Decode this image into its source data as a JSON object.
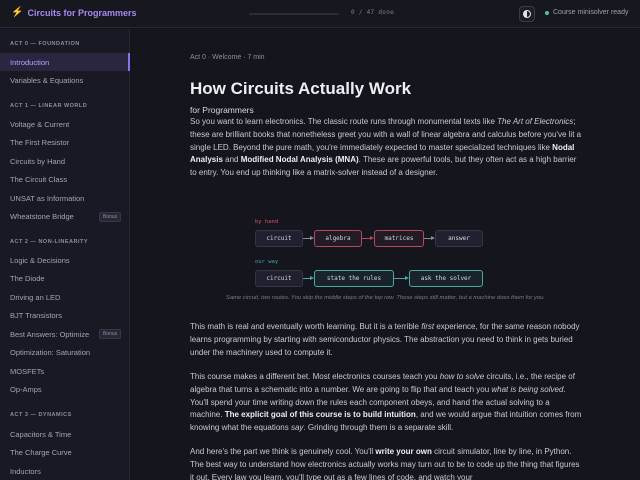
{
  "topbar": {
    "brand_label": "Circuits for Programmers",
    "progress_fraction": 0,
    "progress_text": "0 / 47 done",
    "status_text": "Course minisolver ready"
  },
  "sidebar": {
    "sections": [
      {
        "title": "ACT 0 — FOUNDATION",
        "items": [
          {
            "label": "Introduction",
            "active": true
          },
          {
            "label": "Variables & Equations"
          }
        ]
      },
      {
        "title": "ACT 1 — LINEAR WORLD",
        "items": [
          {
            "label": "Voltage & Current"
          },
          {
            "label": "The First Resistor"
          },
          {
            "label": "Circuits by Hand"
          },
          {
            "label": "The Circuit Class"
          },
          {
            "label": "UNSAT as Information"
          },
          {
            "label": "Wheatstone Bridge",
            "badge": "Bonus"
          }
        ]
      },
      {
        "title": "ACT 2 — NON-LINEARITY",
        "items": [
          {
            "label": "Logic & Decisions"
          },
          {
            "label": "The Diode"
          },
          {
            "label": "Driving an LED"
          },
          {
            "label": "BJT Transistors"
          },
          {
            "label": "Best Answers: Optimize",
            "badge": "Bonus"
          },
          {
            "label": "Optimization: Saturation"
          },
          {
            "label": "MOSFETs"
          },
          {
            "label": "Op-Amps"
          }
        ]
      },
      {
        "title": "ACT 3 — DYNAMICS",
        "items": [
          {
            "label": "Capacitors & Time"
          },
          {
            "label": "The Charge Curve"
          },
          {
            "label": "Inductors"
          }
        ]
      }
    ]
  },
  "main": {
    "breadcrumb": "Act 0 · Welcome · 7 min",
    "title": "How Circuits Actually Work",
    "subtitle": "for Programmers",
    "diagram": {
      "row1_label": "by hand",
      "row1_boxes": [
        "circuit",
        "algebra",
        "matrices",
        "answer"
      ],
      "row2_label": "our way",
      "row2_boxes": [
        "circuit",
        "state the rules",
        "ask the solver"
      ],
      "caption": "Same circuit, two routes. You skip the middle steps of the top row. Those steps still matter, but a machine does them for you."
    },
    "p1": {
      "a": "So you want to learn electronics. The classic route runs through monumental texts like ",
      "b": "The Art of Electronics",
      "c": "; these are brilliant books that nonetheless greet you with a wall of linear algebra and calculus before you've lit a single LED. Beyond the pure math, you're immediately expected to master specialized techniques like ",
      "d": "Nodal Analysis",
      "e": " and ",
      "f": "Modified Nodal Analysis (MNA)",
      "g": ". These are powerful tools, but they often act as a high barrier to entry. You end up thinking like a matrix-solver instead of a designer."
    },
    "p2": {
      "a": "This math is real and eventually worth learning. But it is a terrible ",
      "b": "first",
      "c": " experience, for the same reason nobody learns programming by starting with semiconductor physics. The abstraction you need to think in gets buried under the machinery used to compute it."
    },
    "p3": {
      "a": "This course makes a different bet. Most electronics courses teach you ",
      "b": "how to solve",
      "c": " circuits, i.e., the recipe of algebra that turns a schematic into a number. We are going to flip that and teach you ",
      "d": "what is being solved",
      "e": ". You'll spend your time writing down the rules each component obeys, and hand the actual solving to a machine. ",
      "f": "The explicit goal of this course is to build intuition",
      "g": ", and we would argue that intuition comes from knowing what the equations ",
      "h": "say",
      "i": ". Grinding through them is a separate skill."
    },
    "p4": {
      "a": "And here's the part we think is genuinely cool. You'll ",
      "b": "write your own",
      "c": " circuit simulator, line by line, in Python. The best way to understand how electronics actually works may turn out to be to code up the thing that figures it out. Every law you learn, you'll type out as a few lines of code, and watch your"
    }
  }
}
